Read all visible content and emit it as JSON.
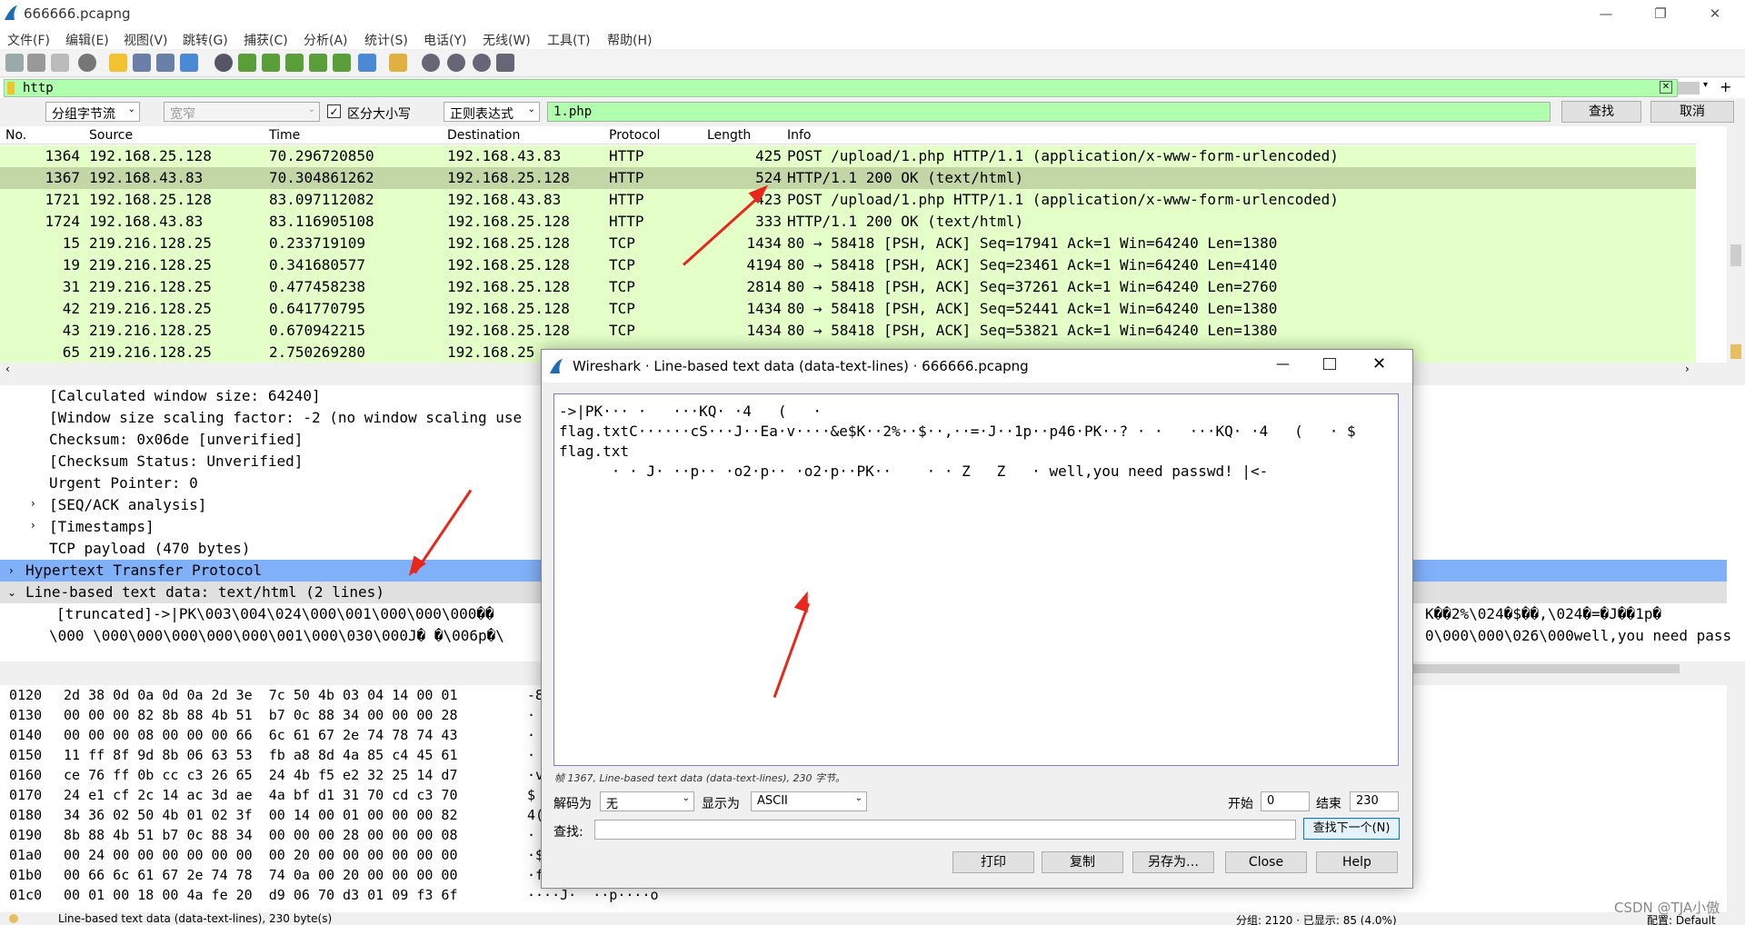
{
  "window": {
    "title": "666666.pcapng",
    "minimize": "—",
    "maximize": "❐",
    "close": "✕"
  },
  "menu": [
    "文件(F)",
    "编辑(E)",
    "视图(V)",
    "跳转(G)",
    "捕获(C)",
    "分析(A)",
    "统计(S)",
    "电话(Y)",
    "无线(W)",
    "工具(T)",
    "帮助(H)"
  ],
  "filter": {
    "value": "http"
  },
  "find": {
    "search_in": "分组字节流",
    "charset": "宽窄",
    "case_label": "区分大小写",
    "case_checked": true,
    "type": "正则表达式",
    "value": "1.php",
    "find_button": "查找",
    "cancel_button": "取消"
  },
  "packet_list": {
    "columns": [
      "No.",
      "Source",
      "Time",
      "Destination",
      "Protocol",
      "Length",
      "Info"
    ],
    "rows": [
      {
        "no": "1364",
        "source": "192.168.25.128",
        "time": "70.296720850",
        "dest": "192.168.43.83",
        "proto": "HTTP",
        "len": "425",
        "info": "POST /upload/1.php HTTP/1.1  (application/x-www-form-urlencoded)"
      },
      {
        "no": "1367",
        "source": "192.168.43.83",
        "time": "70.304861262",
        "dest": "192.168.25.128",
        "proto": "HTTP",
        "len": "524",
        "info": "HTTP/1.1 200 OK  (text/html)"
      },
      {
        "no": "1721",
        "source": "192.168.25.128",
        "time": "83.097112082",
        "dest": "192.168.43.83",
        "proto": "HTTP",
        "len": "423",
        "info": "POST /upload/1.php HTTP/1.1  (application/x-www-form-urlencoded)"
      },
      {
        "no": "1724",
        "source": "192.168.43.83",
        "time": "83.116905108",
        "dest": "192.168.25.128",
        "proto": "HTTP",
        "len": "333",
        "info": "HTTP/1.1 200 OK  (text/html)"
      },
      {
        "no": "15",
        "source": "219.216.128.25",
        "time": "0.233719109",
        "dest": "192.168.25.128",
        "proto": "TCP",
        "len": "1434",
        "info": "80 → 58418 [PSH, ACK] Seq=17941 Ack=1 Win=64240 Len=1380"
      },
      {
        "no": "19",
        "source": "219.216.128.25",
        "time": "0.341680577",
        "dest": "192.168.25.128",
        "proto": "TCP",
        "len": "4194",
        "info": "80 → 58418 [PSH, ACK] Seq=23461 Ack=1 Win=64240 Len=4140"
      },
      {
        "no": "31",
        "source": "219.216.128.25",
        "time": "0.477458238",
        "dest": "192.168.25.128",
        "proto": "TCP",
        "len": "2814",
        "info": "80 → 58418 [PSH, ACK] Seq=37261 Ack=1 Win=64240 Len=2760"
      },
      {
        "no": "42",
        "source": "219.216.128.25",
        "time": "0.641770795",
        "dest": "192.168.25.128",
        "proto": "TCP",
        "len": "1434",
        "info": "80 → 58418 [PSH, ACK] Seq=52441 Ack=1 Win=64240 Len=1380"
      },
      {
        "no": "43",
        "source": "219.216.128.25",
        "time": "0.670942215",
        "dest": "192.168.25.128",
        "proto": "TCP",
        "len": "1434",
        "info": "80 → 58418 [PSH, ACK] Seq=53821 Ack=1 Win=64240 Len=1380"
      },
      {
        "no": "65",
        "source": "219.216.128.25",
        "time": "2.750269280",
        "dest": "192.168.25",
        "proto": "",
        "len": "",
        "info": ""
      }
    ]
  },
  "details": {
    "lines": [
      "[Calculated window size: 64240]",
      "[Window size scaling factor: -2 (no window scaling use",
      "Checksum: 0x06de [unverified]",
      "[Checksum Status: Unverified]",
      "Urgent Pointer: 0",
      "[SEQ/ACK analysis]",
      "[Timestamps]",
      "TCP payload (470 bytes)"
    ],
    "http": "Hypertext Transfer Protocol",
    "linebased": "Line-based text data: text/html (2 lines)",
    "truncated": "[truncated]->|PK\\003\\004\\024\\000\\001\\000\\000\\000��",
    "truncated_right": "K��2%\\024�$��,\\024�=�J��1p�",
    "line2": "\\000 \\000\\000\\000\\000\\000\\001\\000\\030\\000J�  �\\006p�\\",
    "line2_right": "0\\000\\000\\026\\000well,you need pass"
  },
  "bytes": {
    "rows": [
      {
        "off": "0120",
        "hex": "2d 38 0d 0a 0d 0a 2d 3e  7c 50 4b 03 04 14 00 01",
        "asc": "-8"
      },
      {
        "off": "0130",
        "hex": "00 00 00 82 8b 88 4b 51  b7 0c 88 34 00 00 00 28",
        "asc": "·"
      },
      {
        "off": "0140",
        "hex": "00 00 00 08 00 00 00 66  6c 61 67 2e 74 78 74 43",
        "asc": "·"
      },
      {
        "off": "0150",
        "hex": "11 ff 8f 9d 8b 06 63 53  fb a8 8d 4a 85 c4 45 61",
        "asc": "·"
      },
      {
        "off": "0160",
        "hex": "ce 76 ff 0b cc c3 26 65  24 4b f5 e2 32 25 14 d7",
        "asc": "·v"
      },
      {
        "off": "0170",
        "hex": "24 e1 cf 2c 14 ac 3d ae  4a bf d1 31 70 cd c3 70",
        "asc": "$"
      },
      {
        "off": "0180",
        "hex": "34 36 02 50 4b 01 02 3f  00 14 00 01 00 00 00 82",
        "asc": "4("
      },
      {
        "off": "0190",
        "hex": "8b 88 4b 51 b7 0c 88 34  00 00 00 28 00 00 00 08",
        "asc": "·"
      },
      {
        "off": "01a0",
        "hex": "00 24 00 00 00 00 00 00  00 20 00 00 00 00 00 00",
        "asc": "·$"
      },
      {
        "off": "01b0",
        "hex": "00 66 6c 61 67 2e 74 78  74 0a 00 20 00 00 00 00",
        "asc": "·f"
      },
      {
        "off": "01c0",
        "hex": "00 01 00 18 00 4a fe 20  d9 06 70 d3 01 09 f3 6f",
        "asc": "····J·  ··p····o"
      }
    ]
  },
  "status": {
    "left": "Line-based text data (data-text-lines), 230 byte(s)",
    "mid": "分组: 2120 · 已显示: 85 (4.0%)",
    "right": "配置: Default"
  },
  "dialog": {
    "title": "Wireshark · Line-based text data (data-text-lines) · 666666.pcapng",
    "text_lines": [
      "->|PK··· ·   ···KQ· ·4   (   ·",
      "flag.txtC······cS···J··Ea·v····&e$K··2%··$··,··=·J··1p··p46·PK··? · ·   ···KQ· ·4   (   · $",
      "flag.txt",
      "      · · J· ··p·· ·o2·p·· ·o2·p··PK··    · · Z   Z   · well,you need passwd! |<-"
    ],
    "info": "帧 1367, Line-based text data (data-text-lines), 230 字节。",
    "decode_label": "解码为",
    "decode_value": "无",
    "show_label": "显示为",
    "show_value": "ASCII",
    "start_label": "开始",
    "start_value": "0",
    "end_label": "结束",
    "end_value": "230",
    "find_label": "查找:",
    "find_next": "查找下一个(N)",
    "buttons": [
      "打印",
      "复制",
      "另存为…",
      "Close",
      "Help"
    ]
  },
  "watermark": "CSDN @TJA小傲",
  "colors": {
    "filter_bg": "#afffaf",
    "packet_bg": "#e4ffc7",
    "selected_row": "#c3d7a6",
    "http_sel": "#80b0f8",
    "arrow": "#e8261a"
  }
}
